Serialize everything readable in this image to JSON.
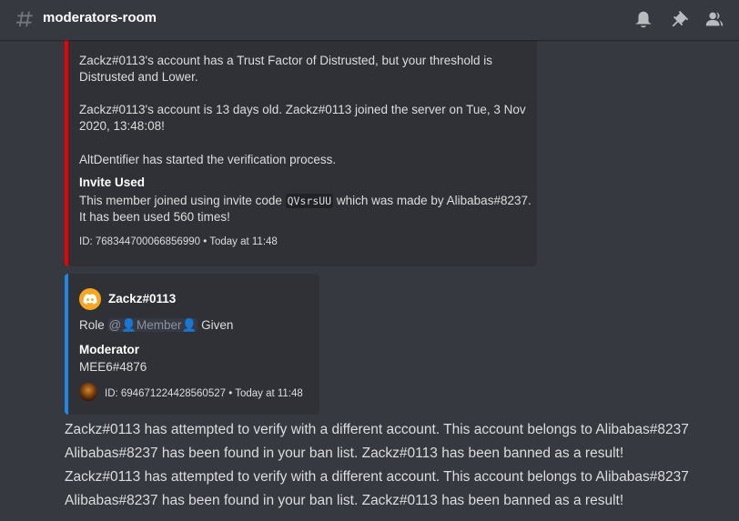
{
  "header": {
    "channel_name": "moderators-room",
    "icons": [
      "hashtag-icon",
      "bell-icon",
      "pin-icon",
      "members-icon"
    ]
  },
  "colors": {
    "background": "#36393f",
    "embed_bg": "#2f3136",
    "red_accent": "#ed0000",
    "blue_accent": "#1e88e5",
    "discord_logo_bg": "#f5a623"
  },
  "embed1": {
    "line1": "Zackz#0113's account has a Trust Factor of Distrusted, but your threshold is",
    "line2": "Distrusted and Lower.",
    "line3": "Zackz#0113's account is 13 days old. Zackz#0113 joined the server on Tue, 3 Nov",
    "line4": "2020, 13:48:08!",
    "line5": "AltDentifier has started the verification process.",
    "field_title": "Invite Used",
    "field_line1_pre": "This member joined using invite code ",
    "field_code": "QVsrsUU",
    "field_line1_post": " which was made by Alibabas#8237.",
    "field_line2": "It has been used 560 times!",
    "footer": "ID: 768344700066856990 • Today at 11:48"
  },
  "embed2": {
    "author": "Zackz#0113",
    "role_pre": "Role ",
    "role_mention": "@👤Member👤",
    "role_post": " Given",
    "field_title": "Moderator",
    "field_value": "MEE6#4876",
    "footer": "ID: 694671224428560527 • Today at 11:48"
  },
  "messages": [
    "Zackz#0113 has attempted to verify with a different account. This account belongs to Alibabas#8237",
    "Alibabas#8237 has been found in your ban list. Zackz#0113 has been banned as a result!",
    "Zackz#0113 has attempted to verify with a different account. This account belongs to Alibabas#8237",
    "Alibabas#8237 has been found in your ban list. Zackz#0113 has been banned as a result!"
  ]
}
